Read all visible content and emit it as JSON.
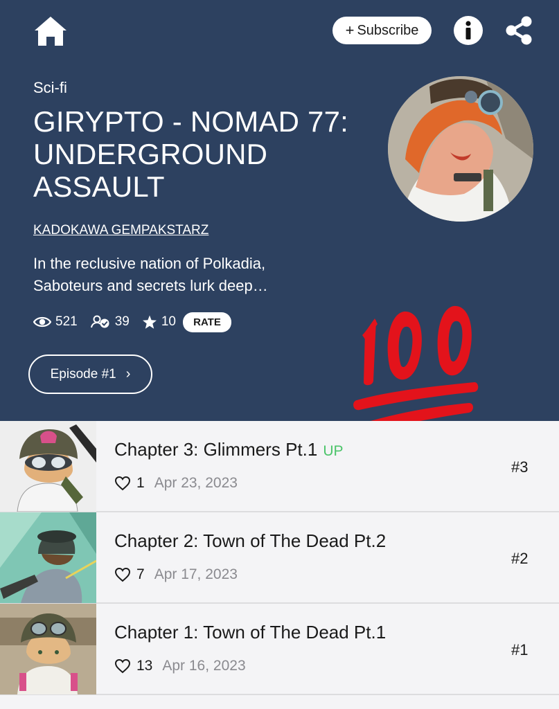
{
  "header": {
    "home_icon": "home-icon",
    "subscribe_plus": "+",
    "subscribe_label": "Subscribe",
    "info_icon": "info-icon",
    "share_icon": "share-icon"
  },
  "series": {
    "genre": "Sci-fi",
    "title": "GIRYPTO - NOMAD 77: UNDERGROUND ASSAULT",
    "author": "KADOKAWA GEMPAKSTARZ",
    "synopsis": "In the reclusive nation of Polkadia, Saboteurs and secrets lurk deep…",
    "stats": {
      "views": "521",
      "subscribers": "39",
      "rating": "10",
      "rate_label": "RATE"
    },
    "episode_button": "Episode #1",
    "episode_chevron": "›"
  },
  "chapters": [
    {
      "title": "Chapter 3: Glimmers Pt.1",
      "badge": "UP",
      "likes": "1",
      "date": "Apr 23, 2023",
      "number": "#3"
    },
    {
      "title": "Chapter 2: Town of The Dead Pt.2",
      "badge": "",
      "likes": "7",
      "date": "Apr 17, 2023",
      "number": "#2"
    },
    {
      "title": "Chapter 1: Town of The Dead Pt.1",
      "badge": "",
      "likes": "13",
      "date": "Apr 16, 2023",
      "number": "#1"
    }
  ],
  "colors": {
    "hero_bg": "#2d4160",
    "up_badge": "#4cc46a",
    "emoji_red": "#e3131b"
  }
}
